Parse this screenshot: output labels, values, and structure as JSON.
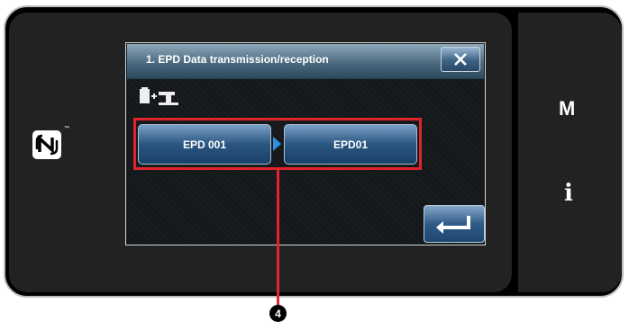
{
  "dialog": {
    "title": "1. EPD Data transmission/reception",
    "close_icon": "close-x-icon",
    "mode_icon": "sd-to-machine-icon"
  },
  "transfer": {
    "source_label": "EPD 001",
    "target_label": "EPD01",
    "arrow_icon": "right-triangle-icon"
  },
  "enter_button": {
    "icon": "enter-return-icon"
  },
  "side_panel": {
    "m_label": "M",
    "info_label": "i"
  },
  "nfc_logo": {
    "icon": "nfc-n-icon",
    "mark": "™"
  },
  "callout": {
    "number": "4"
  },
  "colors": {
    "highlight": "#e0242b",
    "title_bar": "#4c6a80",
    "button": "#2a5680",
    "arrow": "#2f8fe0"
  }
}
